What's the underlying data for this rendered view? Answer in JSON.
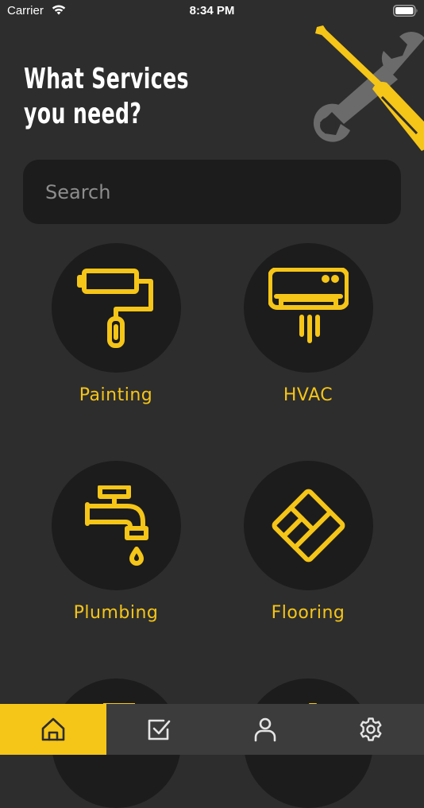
{
  "status_bar": {
    "carrier": "Carrier",
    "time": "8:34 PM"
  },
  "header": {
    "title_line1": "What Services",
    "title_line2": "you need?",
    "art_icon": "screwdriver-wrench-icon"
  },
  "search": {
    "placeholder": "Search",
    "value": ""
  },
  "services": [
    {
      "label": "Painting",
      "icon": "paint-roller-icon"
    },
    {
      "label": "HVAC",
      "icon": "air-conditioner-icon"
    },
    {
      "label": "Plumbing",
      "icon": "faucet-icon"
    },
    {
      "label": "Flooring",
      "icon": "floor-tiles-icon"
    },
    {
      "label": "",
      "icon": "partially-hidden-service"
    },
    {
      "label": "",
      "icon": "partially-hidden-service"
    }
  ],
  "tab_bar": {
    "tabs": [
      {
        "icon": "home-icon",
        "active": true
      },
      {
        "icon": "checkbox-icon",
        "active": false
      },
      {
        "icon": "user-icon",
        "active": false
      },
      {
        "icon": "gear-icon",
        "active": false
      }
    ]
  },
  "colors": {
    "background": "#2d2d2d",
    "surface": "#1c1c1c",
    "accent": "#f5c518",
    "tab_bar": "#3c3c3c",
    "tool_gray": "#6b6b6b"
  }
}
